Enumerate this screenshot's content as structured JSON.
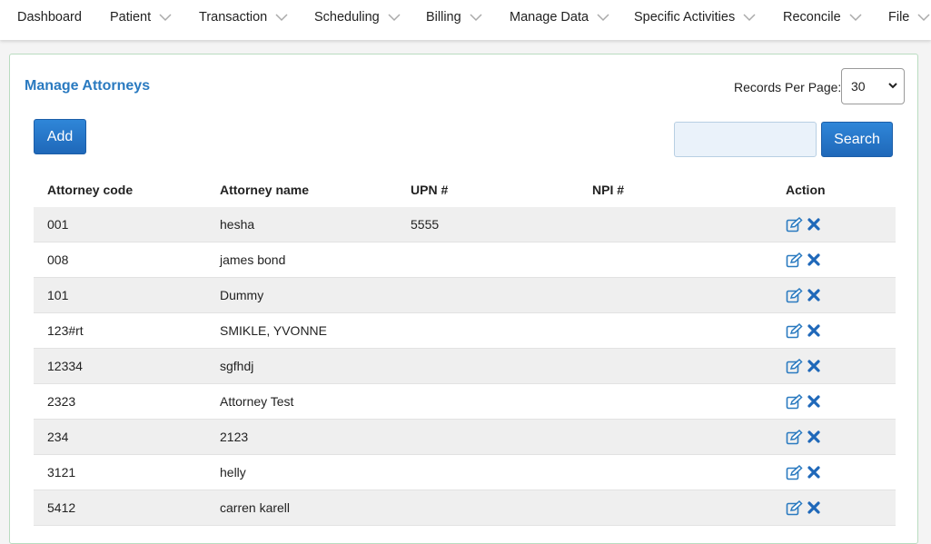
{
  "nav": [
    {
      "label": "Dashboard",
      "has_dropdown": false
    },
    {
      "label": "Patient",
      "has_dropdown": true
    },
    {
      "label": "Transaction",
      "has_dropdown": true
    },
    {
      "label": "Scheduling",
      "has_dropdown": true
    },
    {
      "label": "Billing",
      "has_dropdown": true
    },
    {
      "label": "Manage Data",
      "has_dropdown": true
    },
    {
      "label": "Specific Activities",
      "has_dropdown": true
    },
    {
      "label": "Reconcile",
      "has_dropdown": true
    },
    {
      "label": "File",
      "has_dropdown": true
    }
  ],
  "page": {
    "title": "Manage Attorneys",
    "records_per_page_label": "Records Per Page:",
    "records_per_page_value": "30",
    "add_label": "Add",
    "search_label": "Search",
    "search_value": ""
  },
  "table": {
    "headers": [
      "Attorney code",
      "Attorney name",
      "UPN #",
      "NPI #",
      "Action"
    ],
    "rows": [
      {
        "code": "001",
        "name": "hesha",
        "upn": "5555",
        "npi": ""
      },
      {
        "code": "008",
        "name": "james bond",
        "upn": "",
        "npi": ""
      },
      {
        "code": "101",
        "name": "Dummy",
        "upn": "",
        "npi": ""
      },
      {
        "code": "123#rt",
        "name": "SMIKLE, YVONNE",
        "upn": "",
        "npi": ""
      },
      {
        "code": "12334",
        "name": "sgfhdj",
        "upn": "",
        "npi": ""
      },
      {
        "code": "2323",
        "name": "Attorney Test",
        "upn": "",
        "npi": ""
      },
      {
        "code": "234",
        "name": "2123",
        "upn": "",
        "npi": ""
      },
      {
        "code": "3121",
        "name": "helly",
        "upn": "",
        "npi": ""
      },
      {
        "code": "5412",
        "name": "carren karell",
        "upn": "",
        "npi": ""
      }
    ]
  },
  "icons": {
    "edit": "edit-icon",
    "delete": "delete-icon",
    "chevron": "chevron-down-icon"
  },
  "colors": {
    "accent": "#2a7ac0",
    "button": "#1f68b9",
    "panel_border": "#b9dcc0"
  }
}
